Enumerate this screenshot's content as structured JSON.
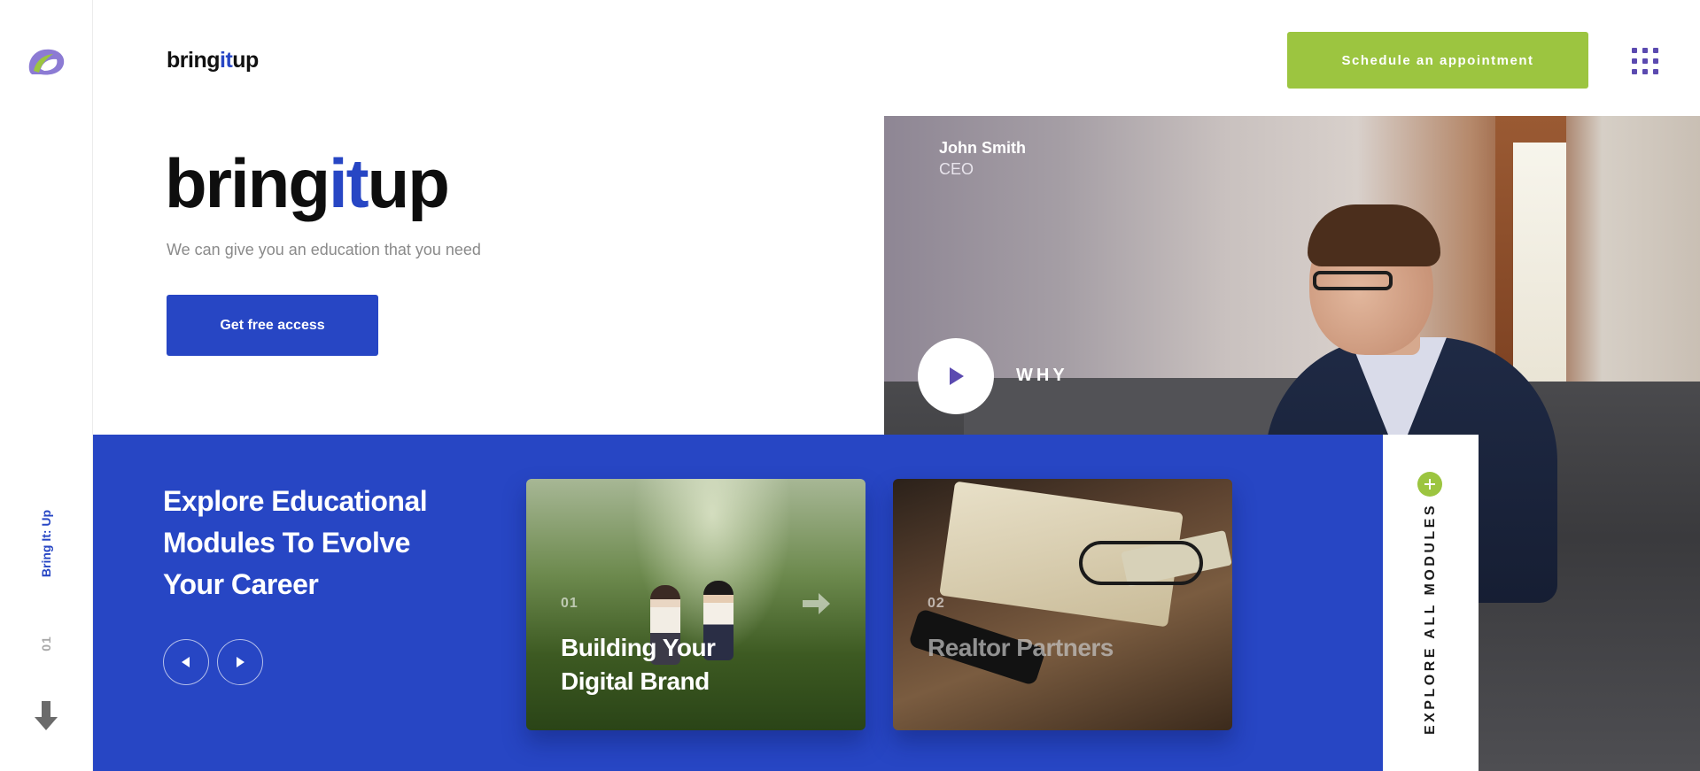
{
  "rail": {
    "logo_icon": "brand-mark-icon",
    "vertical_label": "Bring It: Up",
    "slide_number": "01",
    "scroll_icon": "arrow-down-icon"
  },
  "header": {
    "brand_prefix": "bring",
    "brand_highlight": "it",
    "brand_suffix": "up",
    "appointment_label": "Schedule an appointment",
    "menu_icon": "grid-menu-icon"
  },
  "hero": {
    "title_prefix": "bring",
    "title_highlight": "it",
    "title_suffix": "up",
    "subtitle": "We can give you an education that you need",
    "cta_label": "Get free access",
    "person_name": "John Smith",
    "person_role": "CEO",
    "play_icon": "play-icon",
    "video_label": "WHY"
  },
  "modules": {
    "title": "Explore Educational Modules To Evolve Your Career",
    "prev_icon": "chevron-left-icon",
    "next_icon": "chevron-right-icon",
    "cards": [
      {
        "number": "01",
        "title": "Building Your Digital Brand",
        "arrow_icon": "arrow-right-icon"
      },
      {
        "number": "02",
        "title": "Realtor Partners"
      }
    ],
    "explore_all_label": "EXPLORE ALL MODULES",
    "plus_icon": "plus-icon"
  },
  "colors": {
    "primary_blue": "#2746c4",
    "accent_green": "#9cc540",
    "menu_purple": "#5b4ab0"
  }
}
